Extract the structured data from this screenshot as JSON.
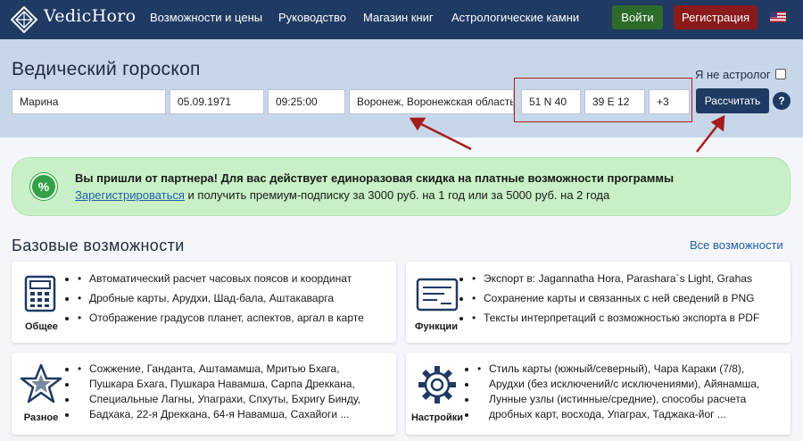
{
  "header": {
    "logo_text": "VedicHoro",
    "nav": [
      "Возможности и цены",
      "Руководство",
      "Магазин книг",
      "Астрологические камни"
    ],
    "login_label": "Войти",
    "register_label": "Регистрация",
    "language_flag": "us-flag-icon"
  },
  "form": {
    "title": "Ведический гороскоп",
    "not_astrologer_label": "Я не астролог",
    "name_value": "Марина",
    "date_value": "05.09.1971",
    "time_value": "09:25:00",
    "place_value": "Воронеж, Воронежская область,",
    "latitude_value": "51 N 40",
    "longitude_value": "39 E 12",
    "timezone_value": "+3",
    "calculate_label": "Рассчитать",
    "help_label": "?"
  },
  "promo": {
    "icon_label": "%",
    "line1": "Вы пришли от партнера! Для вас действует единоразовая скидка на платные возможности программы",
    "link_text": "Зарегистрироваться",
    "line2_rest": " и получить премиум-подписку за 3000 руб. на 1 год или за 5000 руб. на 2 года"
  },
  "features": {
    "title": "Базовые возможности",
    "all_link": "Все возможности",
    "cards": [
      {
        "label": "Общее",
        "icon": "calculator-icon",
        "items": [
          "Автоматический расчет часовых поясов и координат",
          "Дробные карты, Арудхи, Шад-бала, Аштакаварга",
          "Отображение градусов планет, аспектов, аргал в карте"
        ]
      },
      {
        "label": "Функции",
        "icon": "document-icon",
        "items": [
          "Экспорт в: Jagannatha Hora, Parashara`s Light, Grahas",
          "Сохранение карты и связанных с ней сведений в PNG",
          "Тексты интерпретаций с возможностью экспорта в PDF"
        ]
      },
      {
        "label": "Разное",
        "icon": "star-icon",
        "lines": [
          "Сожжение, Ганданта, Аштамамша, Мритью Бхага,",
          "Пушкара Бхага, Пушкара Навамша, Сарпа Дреккана,",
          "Специальные Лагны, Упаграхи, Спхуты, Бхригу Бинду,",
          "Бадхака, 22-я Дреккана, 64-я Навамша, Сахайоги ..."
        ]
      },
      {
        "label": "Настройки",
        "icon": "gear-icon",
        "lines": [
          "Стиль карты (южный/северный), Чара Караки (7/8),",
          "Арудхи (без исключений/с исключениями), Айянамша,",
          "Лунные узлы (истинные/средние), способы расчета",
          "дробных карт, восхода, Упаграх, Таджака-йог ..."
        ]
      }
    ]
  },
  "colors": {
    "header_bg": "#1f3a63",
    "band_bg": "#c8d6e9",
    "login_bg": "#2d6b2b",
    "register_bg": "#8b1a1a",
    "promo_bg": "#c9f0c7",
    "highlight_red": "#b01c1c"
  }
}
